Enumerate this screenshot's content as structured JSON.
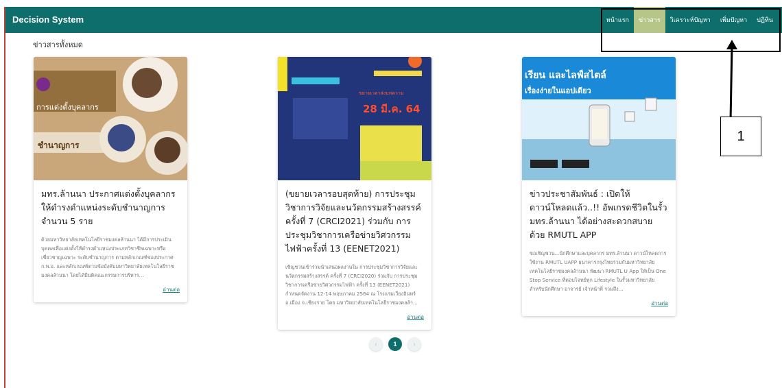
{
  "header": {
    "brand": "Decision System",
    "nav": [
      {
        "label": "หน้าแรก",
        "active": false
      },
      {
        "label": "ข่าวสาร",
        "active": true
      },
      {
        "label": "วิเคราะห์ปัญหา",
        "active": false
      },
      {
        "label": "เพิ่มปัญหา",
        "active": false
      },
      {
        "label": "ปฏิทิน",
        "active": false
      }
    ]
  },
  "annotation": {
    "label": "1"
  },
  "section": {
    "title": "ข่าวสารทั้งหมด"
  },
  "cards": [
    {
      "title": "มทร.ล้านนา ประกาศแต่งตั้งบุคลากรให้ดำรงตำแหน่งระดับชำนาญการ จำนวน 5 ราย",
      "excerpt": "ด้วยมหาวิทยาลัยเทคโนโลยีราชมงคลล้านนา ได้มีการประเมินบุคคลเพื่อแต่งตั้งให้ดำรงตำแหน่งประเภทวิชาชีพเฉพาะหรือเชี่ยวชาญเฉพาะ ระดับชำนาญการ ตามหลักเกณฑ์ของประกาศ ก.พ.อ. และหลักเกณฑ์ตามข้อบังคับมหาวิทยาลัยเทคโนโลยีราชมงคลล้านนา โดยได้มีมติคณะกรรมการบริหาร...",
      "more": "อ่านต่อ",
      "thumb_text": [
        "การแต่งตั้งบุคลากร",
        "ชำนาญการ"
      ]
    },
    {
      "title": "(ขยายเวลารอบสุดท้าย) การประชุมวิชาการวิจัยและนวัตกรรมสร้างสรรค์ครั้งที่ 7 (CRCI2021) ร่วมกับ การประชุมวิชาการเครือข่ายวิศวกรรมไฟฟ้าครั้งที่ 13 (EENET2021)",
      "excerpt": "เชิญชวนเข้าร่วมนำเสนอผลงานใน การประชุมวิชาการวิจัยและนวัตกรรมสร้างสรรค์ ครั้งที่ 7 (CRCI2020) ร่วมกับ การประชุมวิชาการเครือข่ายวิศวกรรมไฟฟ้า ครั้งที่ 13 (EENET2021) กำหนดจัดงาน 12-14 พฤษภาคม 2564 ณ โรงแรมเวียงอินทร์ อ.เมือง จ.เชียงราย โดย มหาวิทยาลัยเทคโนโลยีราชมงคลล้า...",
      "more": "อ่านต่อ",
      "thumb_text": [
        "28 มี.ค. 64",
        "ขยายเวลาส่งบทความ"
      ]
    },
    {
      "title": "ข่าวประชาสัมพันธ์ : เปิดให้ดาวน์โหลดแล้ว..!! อัพเกรดชีวิตในรั้ว มทร.ล้านนา ได้อย่างสะดวกสบาย ด้วย RMUTL APP",
      "excerpt": "ขอเชิญชวน...นักศึกษาและบุคลากร มทร.ล้านนา ดาวน์โหลดการใช้งาน RMUTL UAPP ธนาคารกรุงไทยร่วมกับมหาวิทยาลัยเทคโนโลยีราชมงคลล้านนา พัฒนา RMUTL U App ให้เป็น One Stop Service ที่ตอบโจทย์ทุก Lifestyle ในรั้วมหาวิทยาลัย สำหรับนักศึกษา อาจารย์ เจ้าหน้าที่ รวมถึง...",
      "more": "อ่านต่อ",
      "thumb_text": [
        "เรียน และไลฟ์สไตล์",
        "เรื่องง่ายในแอปเดียว"
      ]
    }
  ],
  "pagination": {
    "prev": "‹",
    "current": "1",
    "next": "›"
  }
}
